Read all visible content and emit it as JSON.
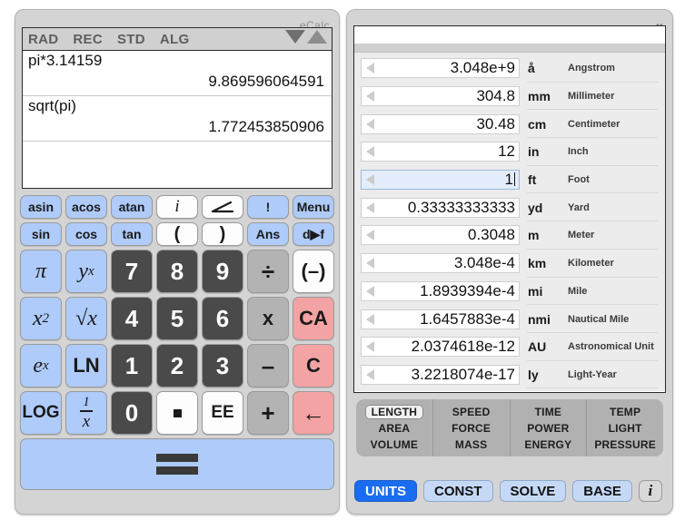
{
  "brand": "eCalc",
  "display": {
    "status": [
      "RAD",
      "REC",
      "STD",
      "ALG"
    ],
    "scroll_down_icon": "triangle-down-icon",
    "scroll_up_icon": "triangle-up-icon",
    "history": [
      {
        "expr": "pi*3.14159",
        "result": "9.869596064591"
      },
      {
        "expr": "sqrt(pi)",
        "result": "1.772453850906"
      }
    ],
    "entry": ""
  },
  "keypad": {
    "row1": [
      "asin",
      "acos",
      "atan",
      "i",
      "angle-icon",
      "!",
      "Menu"
    ],
    "row2": [
      "sin",
      "cos",
      "tan",
      "(",
      ")",
      "Ans",
      "d▶f"
    ],
    "row3": [
      "π",
      "y",
      "7",
      "8",
      "9",
      "÷",
      "(–)"
    ],
    "row4": [
      "x",
      "√x",
      "4",
      "5",
      "6",
      "x",
      "CA"
    ],
    "row5": [
      "e",
      "LN",
      "1",
      "2",
      "3",
      "–",
      "C"
    ],
    "row6": [
      "LOG",
      "1/x",
      "0",
      ".",
      "EE",
      "+",
      "←"
    ],
    "equals": "=",
    "sup": {
      "yx": "x",
      "x2": "2",
      "ex": "x"
    }
  },
  "right_panel": {
    "collapse_icon": "«",
    "units": [
      {
        "value": "3.048e+9",
        "abbr": "å",
        "name": "Angstrom",
        "active": false
      },
      {
        "value": "304.8",
        "abbr": "mm",
        "name": "Millimeter",
        "active": false
      },
      {
        "value": "30.48",
        "abbr": "cm",
        "name": "Centimeter",
        "active": false
      },
      {
        "value": "12",
        "abbr": "in",
        "name": "Inch",
        "active": false
      },
      {
        "value": "1",
        "abbr": "ft",
        "name": "Foot",
        "active": true
      },
      {
        "value": "0.33333333333",
        "abbr": "yd",
        "name": "Yard",
        "active": false
      },
      {
        "value": "0.3048",
        "abbr": "m",
        "name": "Meter",
        "active": false
      },
      {
        "value": "3.048e-4",
        "abbr": "km",
        "name": "Kilometer",
        "active": false
      },
      {
        "value": "1.8939394e-4",
        "abbr": "mi",
        "name": "Mile",
        "active": false
      },
      {
        "value": "1.6457883e-4",
        "abbr": "nmi",
        "name": "Nautical Mile",
        "active": false
      },
      {
        "value": "2.0374618e-12",
        "abbr": "AU",
        "name": "Astronomical Unit",
        "active": false
      },
      {
        "value": "3.2218074e-17",
        "abbr": "ly",
        "name": "Light-Year",
        "active": false
      }
    ],
    "categories": [
      [
        "LENGTH",
        "AREA",
        "VOLUME"
      ],
      [
        "SPEED",
        "FORCE",
        "MASS"
      ],
      [
        "TIME",
        "POWER",
        "ENERGY"
      ],
      [
        "TEMP",
        "LIGHT",
        "PRESSURE"
      ]
    ],
    "selected_category": "LENGTH",
    "modes": [
      {
        "label": "UNITS",
        "on": true
      },
      {
        "label": "CONST",
        "on": false
      },
      {
        "label": "SOLVE",
        "on": false
      },
      {
        "label": "BASE",
        "on": false
      }
    ],
    "info_label": "i"
  },
  "colors": {
    "accent_blue": "#1a6df0",
    "key_blue": "#aecbfa",
    "key_dark": "#4a4a4a",
    "key_red": "#f3a3a3",
    "bezel": "#d4d4d4"
  }
}
